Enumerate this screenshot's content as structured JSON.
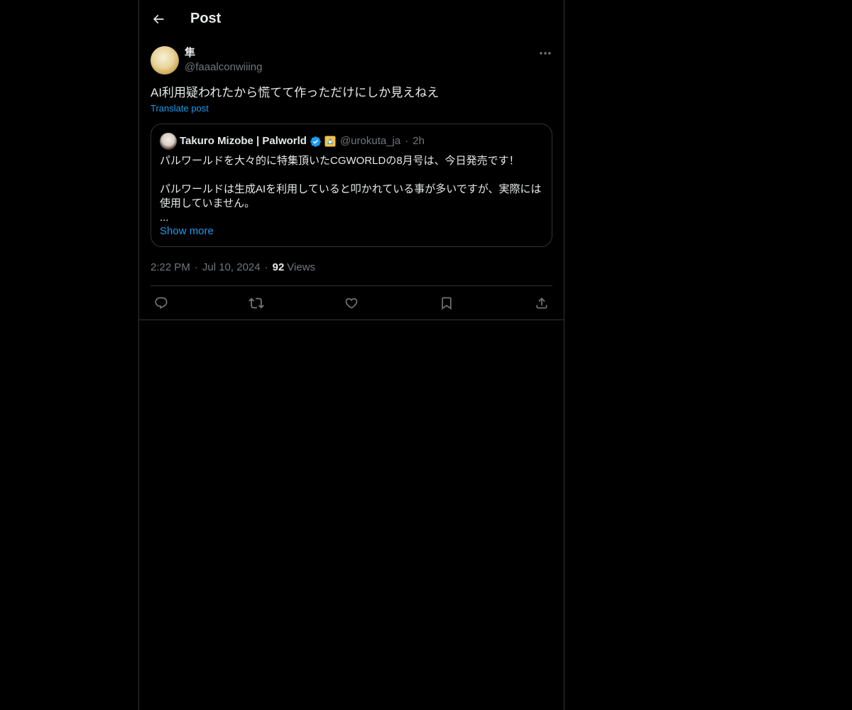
{
  "header": {
    "title": "Post"
  },
  "post": {
    "author": {
      "display_name": "隼",
      "handle": "@faaalconwiiing"
    },
    "text": "AI利用疑われたから慌てて作っただけにしか見えねえ",
    "translate_label": "Translate post",
    "timestamp": "2:22 PM",
    "date": "Jul 10, 2024",
    "views_count": "92",
    "views_label": "Views"
  },
  "quote": {
    "author": {
      "display_name": "Takuro Mizobe | Palworld",
      "handle": "@urokuta_ja",
      "time": "2h"
    },
    "lines": [
      "パルワールドを大々的に特集頂いたCGWORLDの8月号は、今日発売です！",
      "",
      "パルワールドは生成AIを利用していると叩かれている事が多いですが、実際には使用していません。",
      "..."
    ],
    "show_more_label": "Show more"
  },
  "colors": {
    "background": "#000000",
    "border": "#2f3336",
    "text_primary": "#e7e9ea",
    "text_secondary": "#71767b",
    "accent": "#1d9bf0"
  },
  "icons": [
    "back-arrow-icon",
    "more-icon",
    "verified-badge-icon",
    "affiliate-badge-icon",
    "reply-icon",
    "repost-icon",
    "like-icon",
    "bookmark-icon",
    "share-icon"
  ]
}
